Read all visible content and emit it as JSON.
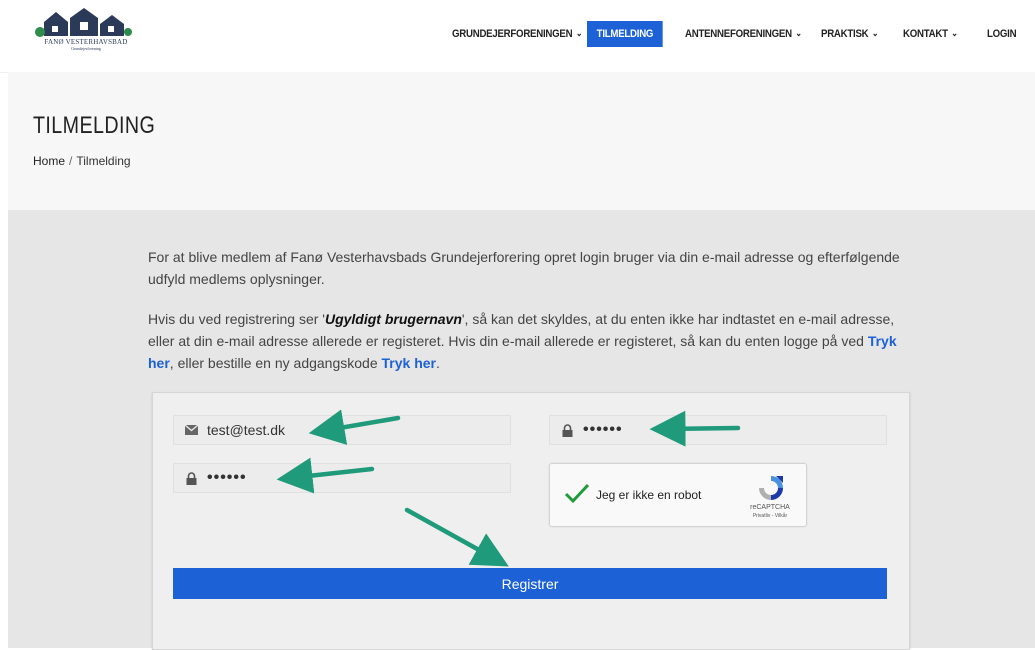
{
  "header": {
    "logo": {
      "title": "FANØ VESTERHAVSBAD",
      "subtitle": "Grundejerforening"
    },
    "nav": [
      {
        "label": "GRUNDEJERFORENINGEN",
        "has_dropdown": true,
        "active": false
      },
      {
        "label": "TILMELDING",
        "has_dropdown": false,
        "active": true
      },
      {
        "label": "ANTENNEFORENINGEN",
        "has_dropdown": true,
        "active": false
      },
      {
        "label": "PRAKTISK",
        "has_dropdown": true,
        "active": false
      },
      {
        "label": "KONTAKT",
        "has_dropdown": true,
        "active": false
      },
      {
        "label": "LOGIN",
        "has_dropdown": false,
        "active": false
      }
    ]
  },
  "page": {
    "title": "TILMELDING",
    "breadcrumb": {
      "home": "Home",
      "separator": "/",
      "current": "Tilmelding"
    }
  },
  "content": {
    "intro": "For at blive medlem af Fanø Vesterhavsbads Grundejerforering opret login bruger via din e-mail adresse og efterfølgende udfyld medlems oplysninger.",
    "info_part1": "Hvis du ved registrering ser '",
    "info_bold": "Ugyldigt brugernavn",
    "info_part2": "', så kan det skyldes, at du enten ikke har indtastet en e-mail adresse, eller at din e-mail adresse allerede er registeret. Hvis din e-mail allerede er registeret, så kan du enten logge på ved ",
    "link1": "Tryk her",
    "info_part3": ", eller bestille en ny adgangskode ",
    "link2": "Tryk her",
    "info_part4": "."
  },
  "form": {
    "email_value": "test@test.dk",
    "password_value": "••••••",
    "confirm_password_value": "••••••",
    "captcha_label": "Jeg er ikke en robot",
    "captcha_brand": "reCAPTCHA",
    "captcha_links": "Privatliv - Vilkår",
    "submit_label": "Registrer"
  },
  "colors": {
    "accent": "#1c61d6",
    "arrow": "#1f9a7a",
    "content_bg": "#e6e6e6",
    "captcha_check": "#1e9c39"
  },
  "icons": [
    "envelope-icon",
    "lock-icon",
    "chevron-down-icon",
    "checkmark-icon",
    "recaptcha-logo-icon",
    "arrow-annotation"
  ]
}
